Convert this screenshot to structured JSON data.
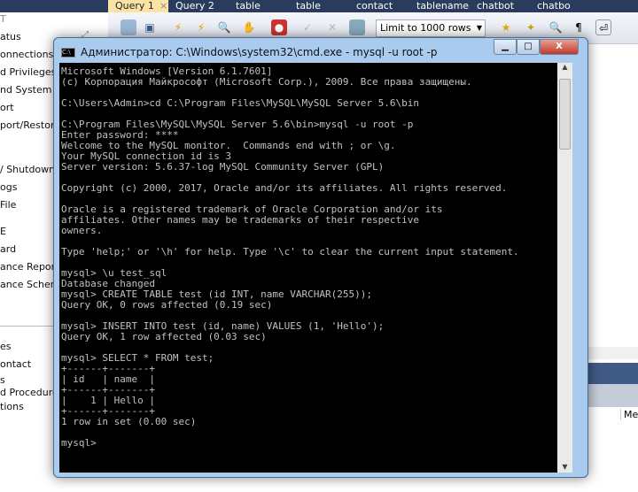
{
  "sidebar": {
    "items": [
      "T",
      "atus",
      "onnections",
      "d Privileges",
      "nd System V",
      "ort",
      "port/Restore",
      "/ Shutdown",
      "ogs",
      "File",
      "E",
      "ard",
      "ance Report",
      "ance Schema",
      "es",
      "ontact",
      "s",
      "d Procedure",
      "tions"
    ]
  },
  "tabs": [
    {
      "label": "Query 1",
      "close": "×"
    },
    {
      "label": "Query 2"
    },
    {
      "label": "table"
    },
    {
      "label": "table"
    },
    {
      "label": "contact"
    },
    {
      "label": "tablename"
    },
    {
      "label": "chatbot"
    },
    {
      "label": "chatbo"
    }
  ],
  "toolbar": {
    "limit": "Limit to 1000 rows"
  },
  "bottom_panel": {
    "label": "Mes"
  },
  "cmd": {
    "title": "Администратор: C:\\Windows\\system32\\cmd.exe - mysql  -u root -p",
    "icon_text": "C:\\",
    "lines": "Microsoft Windows [Version 6.1.7601]\n(c) Корпорация Майкрософт (Microsoft Corp.), 2009. Все права защищены.\n\nC:\\Users\\Admin>cd C:\\Program Files\\MySQL\\MySQL Server 5.6\\bin\n\nC:\\Program Files\\MySQL\\MySQL Server 5.6\\bin>mysql -u root -p\nEnter password: ****\nWelcome to the MySQL monitor.  Commands end with ; or \\g.\nYour MySQL connection id is 3\nServer version: 5.6.37-log MySQL Community Server (GPL)\n\nCopyright (c) 2000, 2017, Oracle and/or its affiliates. All rights reserved.\n\nOracle is a registered trademark of Oracle Corporation and/or its\naffiliates. Other names may be trademarks of their respective\nowners.\n\nType 'help;' or '\\h' for help. Type '\\c' to clear the current input statement.\n\nmysql> \\u test_sql\nDatabase changed\nmysql> CREATE TABLE test (id INT, name VARCHAR(255));\nQuery OK, 0 rows affected (0.19 sec)\n\nmysql> INSERT INTO test (id, name) VALUES (1, 'Hello');\nQuery OK, 1 row affected (0.03 sec)\n\nmysql> SELECT * FROM test;\n+------+-------+\n| id   | name  |\n+------+-------+\n|    1 | Hello |\n+------+-------+\n1 row in set (0.00 sec)\n\nmysql>"
  }
}
